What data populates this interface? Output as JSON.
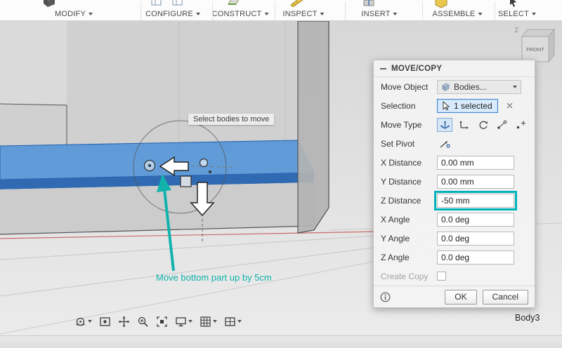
{
  "toolbar": {
    "items": [
      {
        "label": "MODIFY"
      },
      {
        "label": "CONFIGURE"
      },
      {
        "label": "CONSTRUCT"
      },
      {
        "label": "INSPECT"
      },
      {
        "label": "INSERT"
      },
      {
        "label": "ASSEMBLE"
      },
      {
        "label": "SELECT"
      }
    ]
  },
  "viewcube": {
    "front_label": "FRONT",
    "z_axis_label": "Z"
  },
  "viewport": {
    "tooltip": "Select bodies to move",
    "annotation": "Move bottom part up by 5cm",
    "body_label": "Body3"
  },
  "dialog": {
    "title": "MOVE/COPY",
    "rows": [
      {
        "label": "Move Object",
        "value": "Bodies..."
      },
      {
        "label": "Selection",
        "value": "1 selected"
      },
      {
        "label": "Move Type"
      },
      {
        "label": "Set Pivot"
      },
      {
        "label": "X Distance",
        "value": "0.00 mm"
      },
      {
        "label": "Y Distance",
        "value": "0.00 mm"
      },
      {
        "label": "Z Distance",
        "value": "-50 mm"
      },
      {
        "label": "X Angle",
        "value": "0.0 deg"
      },
      {
        "label": "Y Angle",
        "value": "0.0 deg"
      },
      {
        "label": "Z Angle",
        "value": "0.0 deg"
      },
      {
        "label": "Create Copy"
      }
    ],
    "ok_label": "OK",
    "cancel_label": "Cancel",
    "move_type_icons": [
      "free-move",
      "translate",
      "rotate",
      "point-to-point",
      "point-to-position"
    ]
  },
  "nav_toolbar": {
    "icons": [
      "orbit",
      "look-at",
      "pan",
      "zoom",
      "fit",
      "display-settings",
      "grid-and-snaps",
      "viewports"
    ]
  },
  "colors": {
    "selection_blue": "#4e92d6",
    "annotation_teal": "#12b2ad",
    "highlight_teal": "#00b2bc",
    "axis_red": "#cb6b6b"
  }
}
